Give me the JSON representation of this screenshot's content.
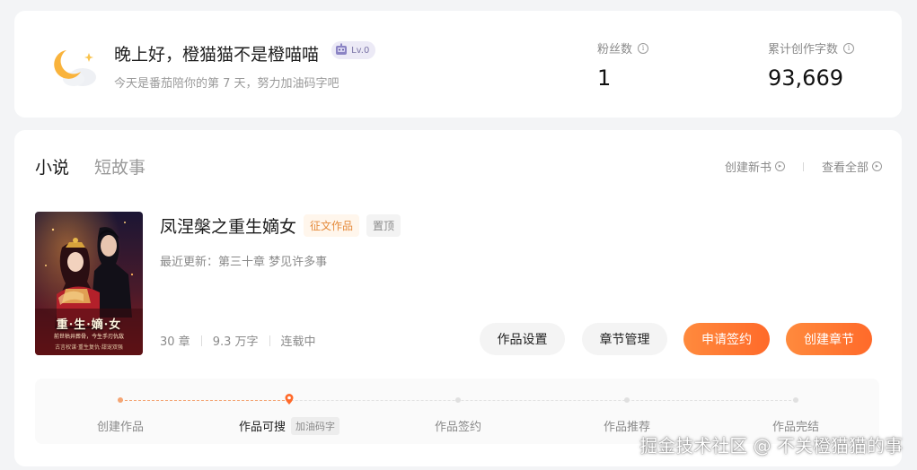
{
  "welcome": {
    "greeting": "晚上好，橙猫猫不是橙喵喵",
    "level": "Lv.0",
    "subtitle": "今天是番茄陪你的第 7 天，努力加油码字吧"
  },
  "stats": [
    {
      "label": "粉丝数",
      "value": "1"
    },
    {
      "label": "累计创作字数",
      "value": "93,669"
    }
  ],
  "tabs": [
    {
      "label": "小说",
      "active": true
    },
    {
      "label": "短故事",
      "active": false
    }
  ],
  "top_links": {
    "create_book": "创建新书",
    "view_all": "查看全部"
  },
  "book": {
    "title": "凤涅槃之重生嫡女",
    "tag_contest": "征文作品",
    "tag_pin": "置顶",
    "latest_update": "最近更新：第三十章 梦见许多事",
    "chapters": "30 章",
    "words": "9.3 万字",
    "status": "连载中",
    "cover": {
      "title": "重·生·嫡·女",
      "subtitle": "前世枯井葬骨，今生手刃仇敌",
      "subtitle2": "古言权谋·重生复仇·甜宠双强"
    }
  },
  "buttons": {
    "settings": "作品设置",
    "chapters": "章节管理",
    "sign": "申请签约",
    "create_chapter": "创建章节"
  },
  "progress": {
    "current_index": 1,
    "steps": [
      {
        "label": "创建作品"
      },
      {
        "label": "作品可搜",
        "badge": "加油码字"
      },
      {
        "label": "作品签约"
      },
      {
        "label": "作品推荐"
      },
      {
        "label": "作品完结"
      }
    ]
  },
  "watermark": "掘金技术社区 @ 不关橙猫猫的事",
  "colors": {
    "accent": "#ff7a33",
    "accent_light": "#f4a574",
    "background": "#f3f4f6",
    "card": "#ffffff"
  }
}
